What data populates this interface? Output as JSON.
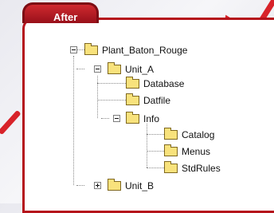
{
  "tab": {
    "label": "After"
  },
  "tree": {
    "root": "Plant_Baton_Rouge",
    "unit_a": "Unit_A",
    "database": "Database",
    "datfile": "Datfile",
    "info": "Info",
    "catalog": "Catalog",
    "menus": "Menus",
    "stdrules": "StdRules",
    "unit_b": "Unit_B"
  },
  "colors": {
    "accent": "#b5121b",
    "arrow": "#d8232a",
    "folder": "#f8e27c"
  }
}
